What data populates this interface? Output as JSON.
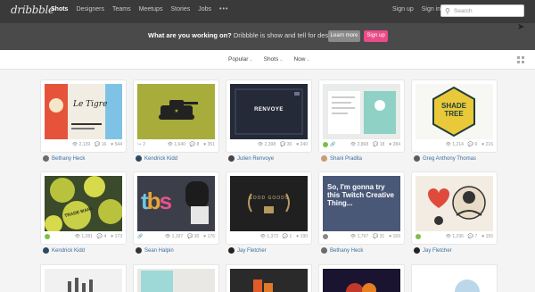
{
  "nav": {
    "logo": "dribbble",
    "links": [
      "Shots",
      "Designers",
      "Teams",
      "Meetups",
      "Stories",
      "Jobs"
    ],
    "more": "•••",
    "signup": "Sign up",
    "signin": "Sign in",
    "search_placeholder": "Search"
  },
  "banner": {
    "question": "What are you working on?",
    "tagline": "Dribbble is show and tell for designers.",
    "learn_more": "Learn more",
    "signup": "Sign up"
  },
  "filters": {
    "popular": "Popular",
    "shots": "Shots",
    "now": "Now"
  },
  "shots": [
    {
      "views": "2,139",
      "comments": "16",
      "likes": "544",
      "author": "Bethany Heck",
      "text": "Le Tigre"
    },
    {
      "views": "1,640",
      "comments": "8",
      "likes": "351",
      "author": "Kendrick Kidd",
      "text": ""
    },
    {
      "views": "2,398",
      "comments": "30",
      "likes": "240",
      "author": "Julien Renvoye",
      "text": "RENVOYE"
    },
    {
      "views": "2,868",
      "comments": "18",
      "likes": "284",
      "author": "Shani Pradita",
      "text": ""
    },
    {
      "views": "1,214",
      "comments": "9",
      "likes": "216",
      "author": "Greg Anthony Thomas",
      "text": "SHADE TREE"
    },
    {
      "views": "1,281",
      "comments": "4",
      "likes": "173",
      "author": "Kendrick Kidd",
      "text": "TRADE MARK"
    },
    {
      "views": "1,197",
      "comments": "30",
      "likes": "176",
      "author": "Sean Halpin",
      "text": "tbs"
    },
    {
      "views": "1,373",
      "comments": "1",
      "likes": "190",
      "author": "Jay Fletcher",
      "text": "GOOD GOODS"
    },
    {
      "views": "1,797",
      "comments": "31",
      "likes": "169",
      "author": "Bethany Heck",
      "text": "So, I'm gonna try this Twitch Creative Thing..."
    },
    {
      "views": "1,236",
      "comments": "7",
      "likes": "155",
      "author": "Jay Fletcher",
      "text": ""
    }
  ]
}
